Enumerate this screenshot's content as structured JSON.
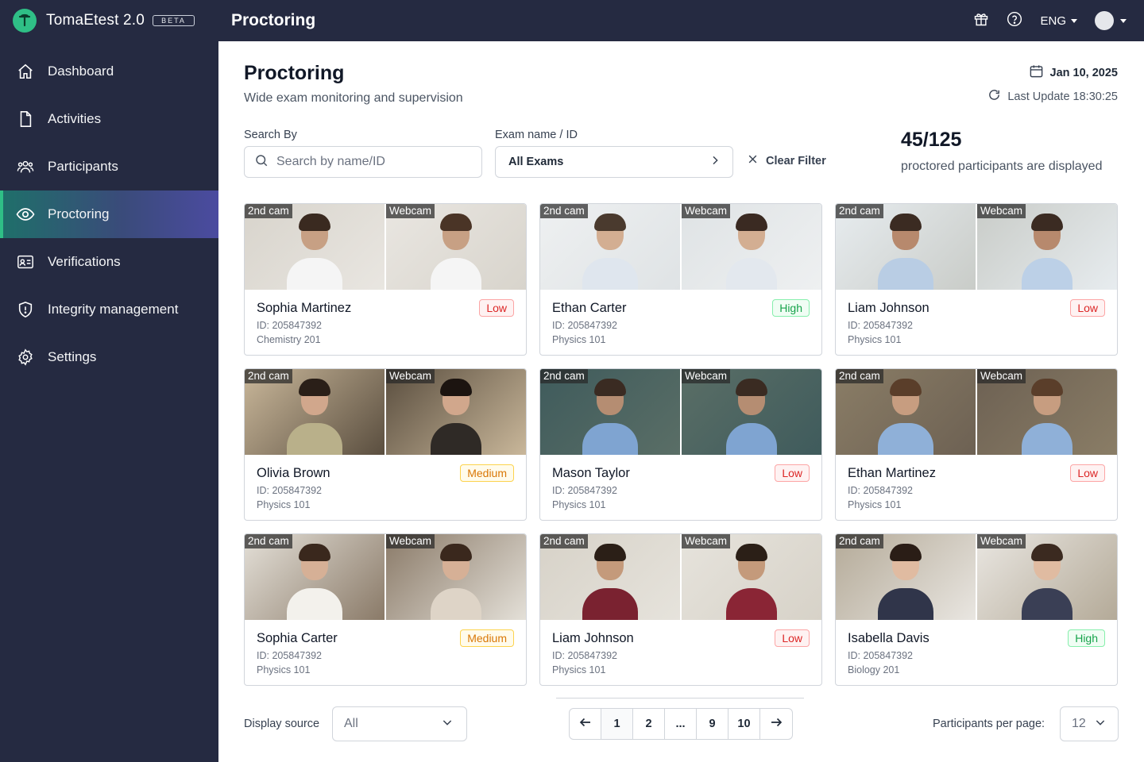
{
  "brand": {
    "name": "TomaEtest 2.0",
    "beta": "BETA",
    "accent": "#2fbf86"
  },
  "sidebar": {
    "items": [
      {
        "label": "Dashboard",
        "icon": "home-icon"
      },
      {
        "label": "Activities",
        "icon": "document-icon"
      },
      {
        "label": "Participants",
        "icon": "users-icon"
      },
      {
        "label": "Proctoring",
        "icon": "eye-icon",
        "active": true
      },
      {
        "label": "Verifications",
        "icon": "id-card-icon"
      },
      {
        "label": "Integrity management",
        "icon": "shield-icon"
      },
      {
        "label": "Settings",
        "icon": "gear-icon"
      }
    ]
  },
  "topbar": {
    "title": "Proctoring",
    "language": "ENG"
  },
  "page": {
    "title": "Proctoring",
    "subtitle": "Wide exam monitoring and supervision",
    "date": "Jan 10, 2025",
    "last_update": "Last Update 18:30:25"
  },
  "filters": {
    "search_label": "Search By",
    "search_placeholder": "Search by name/ID",
    "exam_label": "Exam name / ID",
    "exam_value": "All Exams",
    "clear_label": "Clear Filter"
  },
  "summary": {
    "count": "45/125",
    "caption": "proctored participants are displayed"
  },
  "feed_labels": {
    "second_cam": "2nd cam",
    "webcam": "Webcam"
  },
  "participants": [
    {
      "name": "Sophia Martinez",
      "id": "ID: 205847392",
      "course": "Chemistry 201",
      "risk": "Low",
      "risk_level": "low"
    },
    {
      "name": "Ethan Carter",
      "id": "ID: 205847392",
      "course": "Physics 101",
      "risk": "High",
      "risk_level": "high"
    },
    {
      "name": "Liam Johnson",
      "id": "ID: 205847392",
      "course": "Physics 101",
      "risk": "Low",
      "risk_level": "low"
    },
    {
      "name": "Olivia Brown",
      "id": "ID: 205847392",
      "course": "Physics 101",
      "risk": "Medium",
      "risk_level": "medium"
    },
    {
      "name": "Mason Taylor",
      "id": "ID: 205847392",
      "course": "Physics 101",
      "risk": "Low",
      "risk_level": "low"
    },
    {
      "name": "Ethan Martinez",
      "id": "ID: 205847392",
      "course": "Physics 101",
      "risk": "Low",
      "risk_level": "low"
    },
    {
      "name": "Sophia Carter",
      "id": "ID: 205847392",
      "course": "Physics 101",
      "risk": "Medium",
      "risk_level": "medium"
    },
    {
      "name": "Liam Johnson",
      "id": "ID: 205847392",
      "course": "Physics 101",
      "risk": "Low",
      "risk_level": "low"
    },
    {
      "name": "Isabella Davis",
      "id": "ID: 205847392",
      "course": "Biology 201",
      "risk": "High",
      "risk_level": "high"
    }
  ],
  "footer": {
    "display_source_label": "Display source",
    "display_source_value": "All",
    "pages": [
      "1",
      "2",
      "...",
      "9",
      "10"
    ],
    "current_page": "1",
    "per_page_label": "Participants per page:",
    "per_page_value": "12"
  },
  "colors": {
    "sidebar_bg": "#252a41",
    "active_accent": "#2fbf86",
    "risk_low": "#dc2626",
    "risk_high": "#16a34a",
    "risk_medium": "#d97706"
  }
}
